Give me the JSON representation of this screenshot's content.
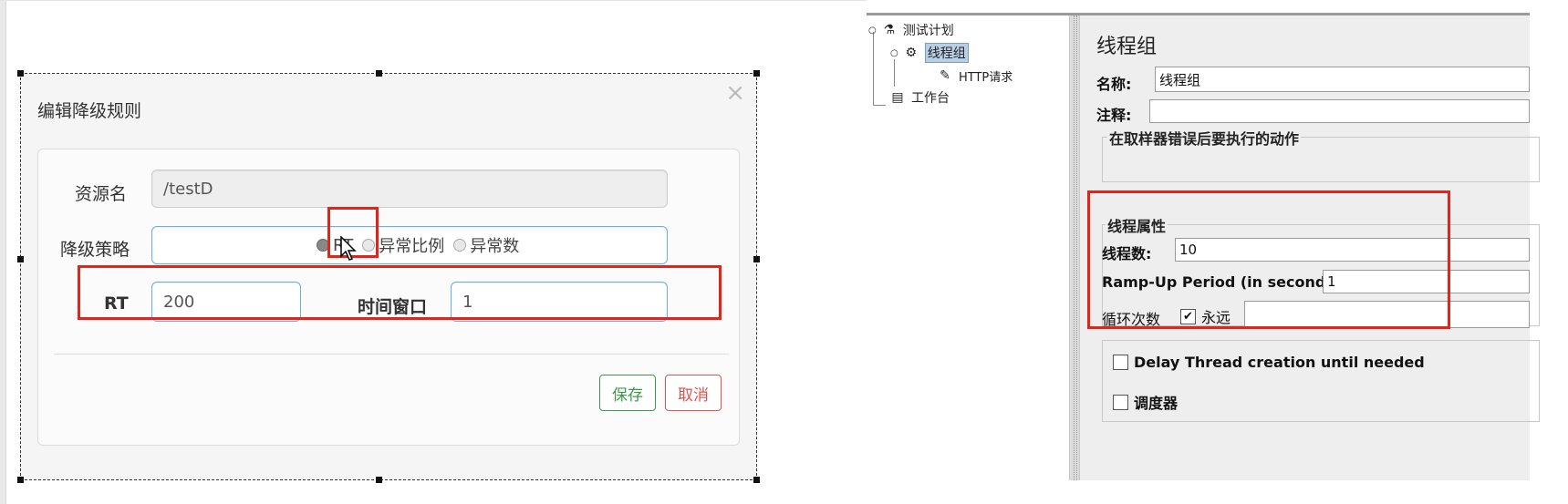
{
  "dialog": {
    "title": "编辑降级规则",
    "close_glyph": "×",
    "resource_label": "资源名",
    "resource_value": "/testD",
    "strategy_label": "降级策略",
    "strategy_options": [
      "RT",
      "异常比例",
      "异常数"
    ],
    "strategy_selected": "RT",
    "rt_label": "RT",
    "rt_value": "200",
    "window_label": "时间窗口",
    "window_value": "1",
    "save_label": "保存",
    "cancel_label": "取消"
  },
  "jmeter": {
    "tree": {
      "items": [
        "测试计划",
        "线程组",
        "HTTP请求",
        "工作台"
      ]
    },
    "panel": {
      "title": "线程组",
      "name_label": "名称:",
      "name_value": "线程组",
      "comment_label": "注释:",
      "comment_value": "",
      "sampler_error_group": "在取样器错误后要执行的动作",
      "thread_props_group": "线程属性",
      "thread_count_label": "线程数:",
      "thread_count_value": "10",
      "rampup_label": "Ramp-Up Period (in seconds):",
      "rampup_value": "1",
      "loop_label": "循环次数",
      "forever_label": "永远",
      "forever_checked": true,
      "delay_label": "Delay Thread creation until needed",
      "scheduler_label": "调度器"
    }
  },
  "colors": {
    "highlight_red": "#e0261b",
    "save_green": "#3c9a4a",
    "cancel_red": "#d9534f",
    "focus_blue": "#66afe9"
  }
}
